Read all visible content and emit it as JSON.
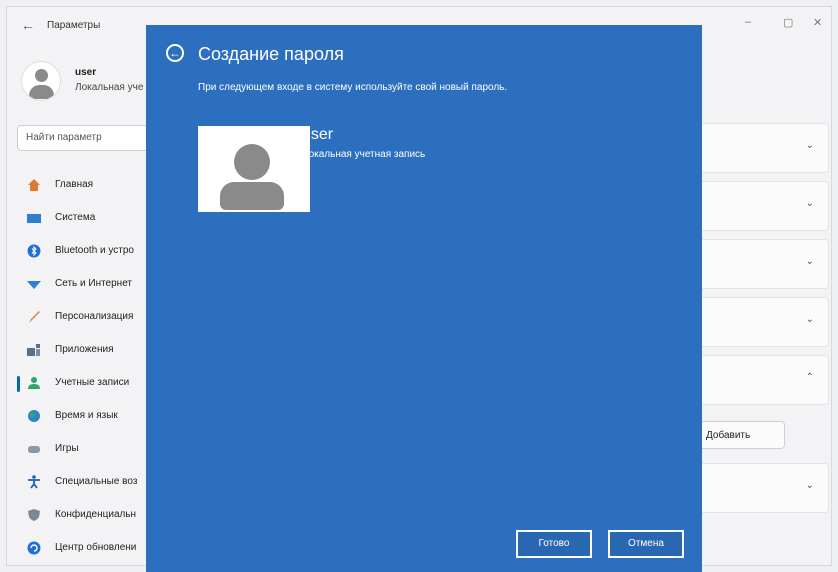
{
  "window": {
    "back_glyph": "←",
    "title": "Параметры",
    "controls": [
      "–",
      "▢",
      "✕"
    ]
  },
  "user": {
    "name": "user",
    "type_truncated": "Локальная уче"
  },
  "search": {
    "placeholder": "Найти параметр"
  },
  "sidebar": {
    "items": [
      {
        "label": "Главная",
        "icon": "home-icon"
      },
      {
        "label": "Система",
        "icon": "system-icon"
      },
      {
        "label": "Bluetooth и устро",
        "icon": "bluetooth-icon"
      },
      {
        "label": "Сеть и Интернет",
        "icon": "network-icon"
      },
      {
        "label": "Персонализация",
        "icon": "brush-icon"
      },
      {
        "label": "Приложения",
        "icon": "apps-icon"
      },
      {
        "label": "Учетные записи",
        "icon": "accounts-icon",
        "active": true
      },
      {
        "label": "Время и язык",
        "icon": "globe-icon"
      },
      {
        "label": "Игры",
        "icon": "gamepad-icon"
      },
      {
        "label": "Специальные воз",
        "icon": "accessibility-icon"
      },
      {
        "label": "Конфиденциальн",
        "icon": "shield-icon"
      },
      {
        "label": "Центр обновлени",
        "icon": "update-icon"
      }
    ]
  },
  "background_panel": {
    "add_label": "Добавить",
    "chevrons": [
      "⌄",
      "⌄",
      "⌄",
      "⌄",
      "⌃",
      "⌄"
    ]
  },
  "dialog": {
    "back_glyph": "←",
    "title": "Создание пароля",
    "subtitle": "При следующем входе в систему используйте свой новый пароль.",
    "account_name": "user",
    "account_type": "Локальная учетная запись",
    "done_label": "Готово",
    "cancel_label": "Отмена"
  },
  "colors": {
    "dialog_bg": "#2d6fbf",
    "accent": "#0067c0"
  }
}
